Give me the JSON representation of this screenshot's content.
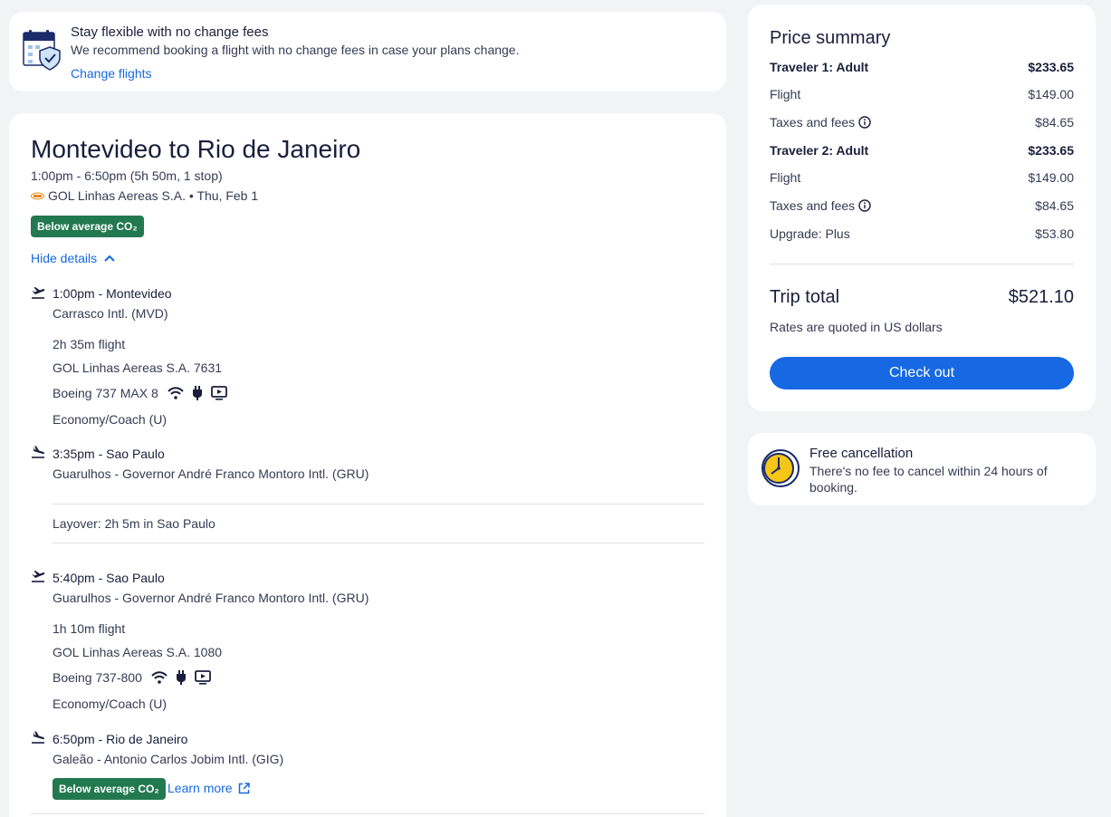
{
  "banner": {
    "icon": "calendar-shield-icon",
    "title": "Stay flexible with no change fees",
    "description": "We recommend booking a flight with no change fees in case your plans change.",
    "link": "Change flights"
  },
  "itinerary": {
    "title": "Montevideo to Rio de Janeiro",
    "times": "1:00pm - 6:50pm (5h 50m, 1 stop)",
    "airline_date": "GOL Linhas Aereas S.A. • Thu, Feb 1",
    "co2_badge": "Below average CO₂",
    "hide_details": "Hide details",
    "segments": [
      {
        "departure": "1:00pm - Montevideo",
        "departure_airport": "Carrasco Intl. (MVD)",
        "duration": "2h 35m flight",
        "flight": "GOL Linhas Aereas S.A. 7631",
        "aircraft": "Boeing 737 MAX 8",
        "cabin": "Economy/Coach (U)",
        "arrival": "3:35pm - Sao Paulo",
        "arrival_airport": "Guarulhos - Governor André Franco Montoro Intl. (GRU)"
      },
      {
        "departure": "5:40pm - Sao Paulo",
        "departure_airport": "Guarulhos - Governor André Franco Montoro Intl. (GRU)",
        "duration": "1h 10m flight",
        "flight": "GOL Linhas Aereas S.A. 1080",
        "aircraft": "Boeing 737-800",
        "cabin": "Economy/Coach (U)",
        "arrival": "6:50pm - Rio de Janeiro",
        "arrival_airport": "Galeão - Antonio Carlos Jobim Intl. (GIG)"
      }
    ],
    "layover": "Layover: 2h 5m in Sao Paulo",
    "bottom_co2_badge": "Below average CO₂",
    "learn_more": "Learn more"
  },
  "price_summary": {
    "title": "Price summary",
    "rows": [
      {
        "label": "Traveler 1: Adult",
        "value": "$233.65",
        "bold": true
      },
      {
        "label": "Flight",
        "value": "$149.00"
      },
      {
        "label": "Taxes and fees",
        "value": "$84.65",
        "info": true
      },
      {
        "label": "Traveler 2: Adult",
        "value": "$233.65",
        "bold": true
      },
      {
        "label": "Flight",
        "value": "$149.00"
      },
      {
        "label": "Taxes and fees",
        "value": "$84.65",
        "info": true
      },
      {
        "label": "Upgrade: Plus",
        "value": "$53.80"
      }
    ],
    "total_label": "Trip total",
    "total_value": "$521.10",
    "rates_note": "Rates are quoted in US dollars",
    "checkout": "Check out"
  },
  "cancellation": {
    "icon": "clock-icon",
    "title": "Free cancellation",
    "description": "There's no fee to cancel within 24 hours of booking."
  },
  "colors": {
    "primary": "#1668e3",
    "co2_green": "#227950",
    "text": "#191e3b",
    "background": "#f2f3f5"
  }
}
